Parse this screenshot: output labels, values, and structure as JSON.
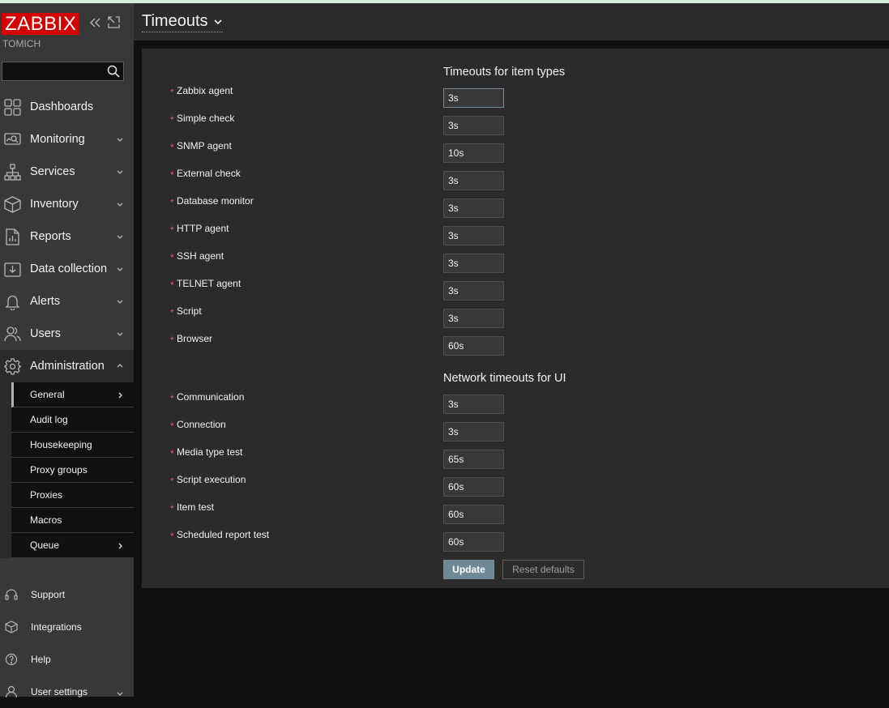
{
  "app": {
    "logo_text": "ZABBIX",
    "server_name": "TOMICH",
    "brand_color": "#d40000"
  },
  "search": {
    "value": "",
    "placeholder": ""
  },
  "nav": {
    "items": [
      {
        "label": "Dashboards",
        "icon": "dashboard-icon"
      },
      {
        "label": "Monitoring",
        "icon": "monitoring-icon"
      },
      {
        "label": "Services",
        "icon": "services-icon"
      },
      {
        "label": "Inventory",
        "icon": "inventory-icon"
      },
      {
        "label": "Reports",
        "icon": "reports-icon"
      },
      {
        "label": "Data collection",
        "icon": "data-collection-icon"
      },
      {
        "label": "Alerts",
        "icon": "alerts-icon"
      },
      {
        "label": "Users",
        "icon": "users-icon"
      },
      {
        "label": "Administration",
        "icon": "administration-icon"
      }
    ],
    "admin_submenu": [
      "General",
      "Audit log",
      "Housekeeping",
      "Proxy groups",
      "Proxies",
      "Macros",
      "Queue"
    ],
    "bottom": [
      {
        "label": "Support",
        "icon": "support-icon"
      },
      {
        "label": "Integrations",
        "icon": "integrations-icon"
      },
      {
        "label": "Help",
        "icon": "help-icon"
      },
      {
        "label": "User settings",
        "icon": "user-settings-icon"
      }
    ]
  },
  "header": {
    "title": "Timeouts"
  },
  "form": {
    "item_types_title": "Timeouts for item types",
    "item_types": [
      {
        "label": "Zabbix agent",
        "value": "3s"
      },
      {
        "label": "Simple check",
        "value": "3s"
      },
      {
        "label": "SNMP agent",
        "value": "10s"
      },
      {
        "label": "External check",
        "value": "3s"
      },
      {
        "label": "Database monitor",
        "value": "3s"
      },
      {
        "label": "HTTP agent",
        "value": "3s"
      },
      {
        "label": "SSH agent",
        "value": "3s"
      },
      {
        "label": "TELNET agent",
        "value": "3s"
      },
      {
        "label": "Script",
        "value": "3s"
      },
      {
        "label": "Browser",
        "value": "60s"
      }
    ],
    "network_title": "Network timeouts for UI",
    "network": [
      {
        "label": "Communication",
        "value": "3s"
      },
      {
        "label": "Connection",
        "value": "3s"
      },
      {
        "label": "Media type test",
        "value": "65s"
      },
      {
        "label": "Script execution",
        "value": "60s"
      },
      {
        "label": "Item test",
        "value": "60s"
      },
      {
        "label": "Scheduled report test",
        "value": "60s"
      }
    ],
    "required_marker": "*",
    "update_label": "Update",
    "reset_label": "Reset defaults"
  }
}
